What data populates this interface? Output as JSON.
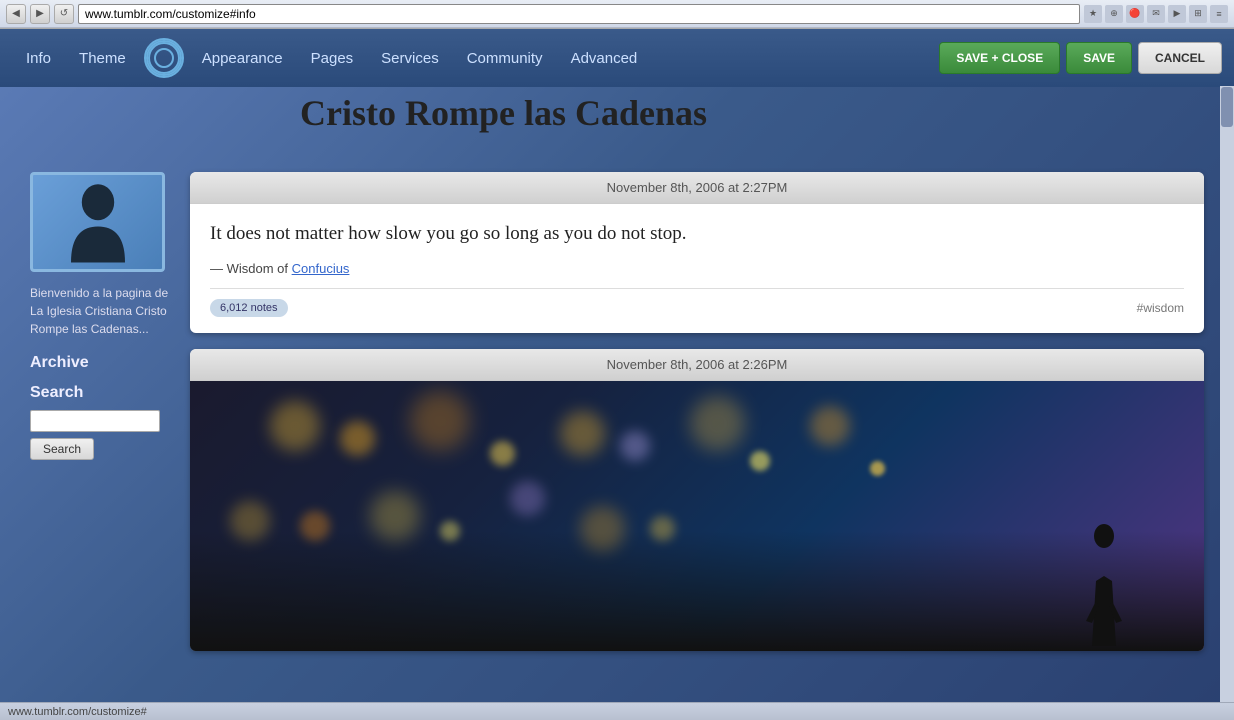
{
  "browser": {
    "url": "www.tumblr.com/customize#info",
    "back_btn": "◀",
    "forward_btn": "▶",
    "refresh_btn": "↺",
    "status_url": "www.tumblr.com/customize#"
  },
  "nav": {
    "info_label": "Info",
    "theme_label": "Theme",
    "appearance_label": "Appearance",
    "pages_label": "Pages",
    "services_label": "Services",
    "community_label": "Community",
    "advanced_label": "Advanced",
    "save_close_label": "SAVE + CLOSE",
    "save_label": "SAVE",
    "cancel_label": "CANCEL"
  },
  "blog": {
    "title": "Cristo Rompe las Cadenas",
    "description": "Bienvenido a la pagina de La Iglesia Cristiana Cristo Rompe las Cadenas...",
    "archive_label": "Archive",
    "search_label": "Search",
    "search_btn_label": "Search",
    "search_placeholder": ""
  },
  "posts": [
    {
      "timestamp": "November 8th, 2006 at 2:27PM",
      "type": "quote",
      "quote": "It does not matter how slow you go so long as you do not stop.",
      "attribution": "— Wisdom of Confucius",
      "attribution_link": "Confucius",
      "notes": "6,012 notes",
      "tag": "#wisdom"
    },
    {
      "timestamp": "November 8th, 2006 at 2:26PM",
      "type": "photo",
      "quote": "",
      "attribution": "",
      "notes": "",
      "tag": ""
    }
  ]
}
